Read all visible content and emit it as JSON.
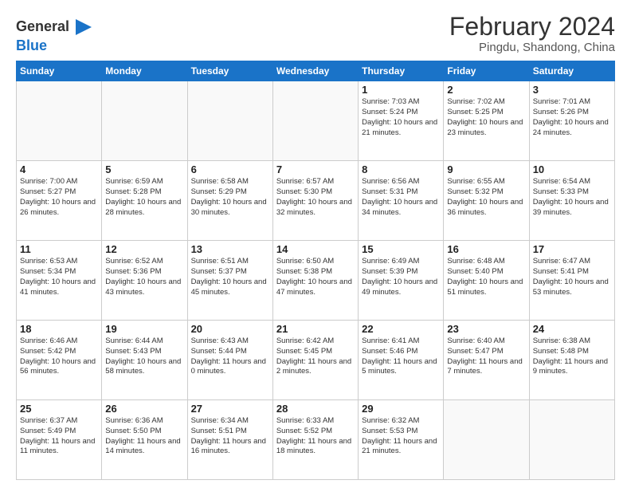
{
  "logo": {
    "line1": "General",
    "line2": "Blue"
  },
  "title": "February 2024",
  "subtitle": "Pingdu, Shandong, China",
  "days_of_week": [
    "Sunday",
    "Monday",
    "Tuesday",
    "Wednesday",
    "Thursday",
    "Friday",
    "Saturday"
  ],
  "weeks": [
    [
      {
        "day": "",
        "info": ""
      },
      {
        "day": "",
        "info": ""
      },
      {
        "day": "",
        "info": ""
      },
      {
        "day": "",
        "info": ""
      },
      {
        "day": "1",
        "info": "Sunrise: 7:03 AM\nSunset: 5:24 PM\nDaylight: 10 hours and 21 minutes."
      },
      {
        "day": "2",
        "info": "Sunrise: 7:02 AM\nSunset: 5:25 PM\nDaylight: 10 hours and 23 minutes."
      },
      {
        "day": "3",
        "info": "Sunrise: 7:01 AM\nSunset: 5:26 PM\nDaylight: 10 hours and 24 minutes."
      }
    ],
    [
      {
        "day": "4",
        "info": "Sunrise: 7:00 AM\nSunset: 5:27 PM\nDaylight: 10 hours and 26 minutes."
      },
      {
        "day": "5",
        "info": "Sunrise: 6:59 AM\nSunset: 5:28 PM\nDaylight: 10 hours and 28 minutes."
      },
      {
        "day": "6",
        "info": "Sunrise: 6:58 AM\nSunset: 5:29 PM\nDaylight: 10 hours and 30 minutes."
      },
      {
        "day": "7",
        "info": "Sunrise: 6:57 AM\nSunset: 5:30 PM\nDaylight: 10 hours and 32 minutes."
      },
      {
        "day": "8",
        "info": "Sunrise: 6:56 AM\nSunset: 5:31 PM\nDaylight: 10 hours and 34 minutes."
      },
      {
        "day": "9",
        "info": "Sunrise: 6:55 AM\nSunset: 5:32 PM\nDaylight: 10 hours and 36 minutes."
      },
      {
        "day": "10",
        "info": "Sunrise: 6:54 AM\nSunset: 5:33 PM\nDaylight: 10 hours and 39 minutes."
      }
    ],
    [
      {
        "day": "11",
        "info": "Sunrise: 6:53 AM\nSunset: 5:34 PM\nDaylight: 10 hours and 41 minutes."
      },
      {
        "day": "12",
        "info": "Sunrise: 6:52 AM\nSunset: 5:36 PM\nDaylight: 10 hours and 43 minutes."
      },
      {
        "day": "13",
        "info": "Sunrise: 6:51 AM\nSunset: 5:37 PM\nDaylight: 10 hours and 45 minutes."
      },
      {
        "day": "14",
        "info": "Sunrise: 6:50 AM\nSunset: 5:38 PM\nDaylight: 10 hours and 47 minutes."
      },
      {
        "day": "15",
        "info": "Sunrise: 6:49 AM\nSunset: 5:39 PM\nDaylight: 10 hours and 49 minutes."
      },
      {
        "day": "16",
        "info": "Sunrise: 6:48 AM\nSunset: 5:40 PM\nDaylight: 10 hours and 51 minutes."
      },
      {
        "day": "17",
        "info": "Sunrise: 6:47 AM\nSunset: 5:41 PM\nDaylight: 10 hours and 53 minutes."
      }
    ],
    [
      {
        "day": "18",
        "info": "Sunrise: 6:46 AM\nSunset: 5:42 PM\nDaylight: 10 hours and 56 minutes."
      },
      {
        "day": "19",
        "info": "Sunrise: 6:44 AM\nSunset: 5:43 PM\nDaylight: 10 hours and 58 minutes."
      },
      {
        "day": "20",
        "info": "Sunrise: 6:43 AM\nSunset: 5:44 PM\nDaylight: 11 hours and 0 minutes."
      },
      {
        "day": "21",
        "info": "Sunrise: 6:42 AM\nSunset: 5:45 PM\nDaylight: 11 hours and 2 minutes."
      },
      {
        "day": "22",
        "info": "Sunrise: 6:41 AM\nSunset: 5:46 PM\nDaylight: 11 hours and 5 minutes."
      },
      {
        "day": "23",
        "info": "Sunrise: 6:40 AM\nSunset: 5:47 PM\nDaylight: 11 hours and 7 minutes."
      },
      {
        "day": "24",
        "info": "Sunrise: 6:38 AM\nSunset: 5:48 PM\nDaylight: 11 hours and 9 minutes."
      }
    ],
    [
      {
        "day": "25",
        "info": "Sunrise: 6:37 AM\nSunset: 5:49 PM\nDaylight: 11 hours and 11 minutes."
      },
      {
        "day": "26",
        "info": "Sunrise: 6:36 AM\nSunset: 5:50 PM\nDaylight: 11 hours and 14 minutes."
      },
      {
        "day": "27",
        "info": "Sunrise: 6:34 AM\nSunset: 5:51 PM\nDaylight: 11 hours and 16 minutes."
      },
      {
        "day": "28",
        "info": "Sunrise: 6:33 AM\nSunset: 5:52 PM\nDaylight: 11 hours and 18 minutes."
      },
      {
        "day": "29",
        "info": "Sunrise: 6:32 AM\nSunset: 5:53 PM\nDaylight: 11 hours and 21 minutes."
      },
      {
        "day": "",
        "info": ""
      },
      {
        "day": "",
        "info": ""
      }
    ]
  ]
}
